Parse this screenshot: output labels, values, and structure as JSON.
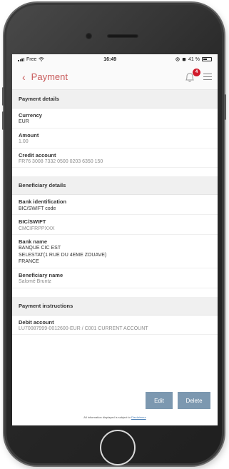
{
  "status_bar": {
    "carrier": "Free",
    "time": "16:49",
    "battery": "41 %"
  },
  "nav": {
    "title": "Payment",
    "notification_count": "4"
  },
  "sections": {
    "payment_details": {
      "header": "Payment details",
      "currency_label": "Currency",
      "currency_value": "EUR",
      "amount_label": "Amount",
      "amount_value": "1.00",
      "credit_account_label": "Credit account",
      "credit_account_value": "FR76 3008 7332 0500 0203 6350 150"
    },
    "beneficiary_details": {
      "header": "Beneficiary details",
      "bank_identification_label": "Bank identification",
      "bank_identification_value": "BIC/SWIFT code",
      "bic_label": "BIC/SWIFT",
      "bic_value": "CMCIFRPPXXX",
      "bank_name_label": "Bank name",
      "bank_name_line1": "BANQUE CIC EST",
      "bank_name_line2": "SELESTAT(1 RUE DU 4EME ZOUAVE)",
      "bank_name_line3": "FRANCE",
      "beneficiary_name_label": "Beneficiary name",
      "beneficiary_name_value": "Salomé Bruntz"
    },
    "payment_instructions": {
      "header": "Payment instructions",
      "debit_account_label": "Debit account",
      "debit_account_value": "LU70087999-0012600-EUR / C001 CURRENT ACCOUNT"
    }
  },
  "actions": {
    "edit_label": "Edit",
    "delete_label": "Delete"
  },
  "footer": {
    "disclaimer_text": "All information displayed is subject to",
    "disclaimer_link": "Disclaimers"
  },
  "colors": {
    "accent": "#c85a5a",
    "button": "#7c98b0",
    "badge": "#d01a2b"
  }
}
